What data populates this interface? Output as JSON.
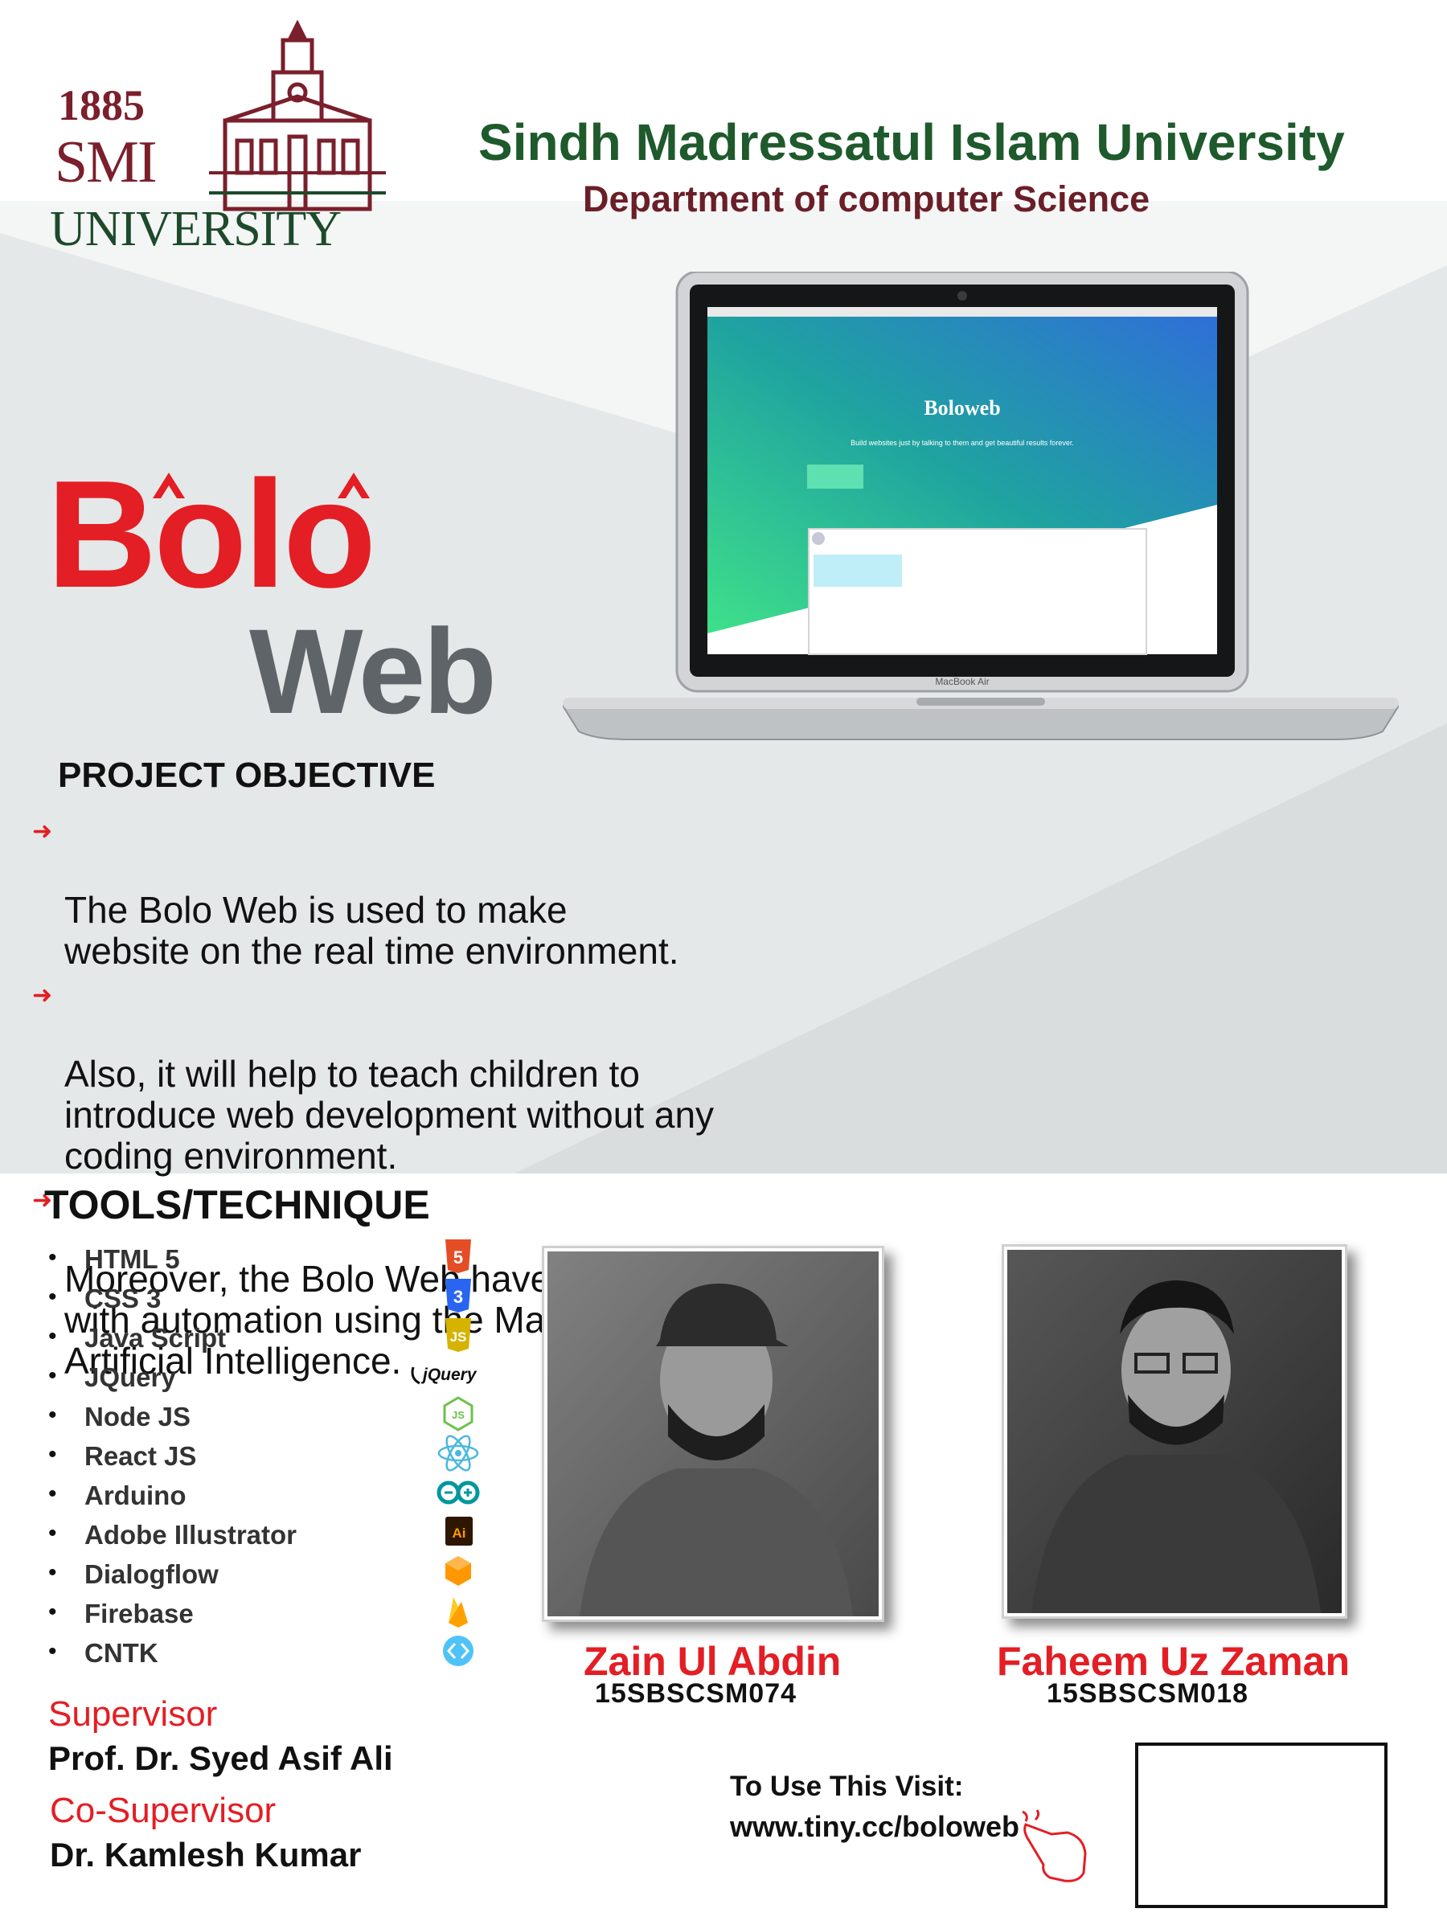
{
  "header": {
    "logo": {
      "year": "1885",
      "smi": "SMI",
      "university": "UNIVERSITY"
    },
    "university_title": "Sindh Madressatul Islam University",
    "department_title": "Department of computer Science"
  },
  "laptop_screen": {
    "app_title": "Boloweb",
    "tagline": "Build websites just by talking to them and get beautiful results forever.",
    "device_label": "MacBook Air"
  },
  "brand": {
    "line1": "Bolo",
    "line2": "Web"
  },
  "objective": {
    "title": "PROJECT OBJECTIVE",
    "items": [
      "The Bolo Web is used to make\nwebsite on the real time environment.",
      "Also, it will help to teach children to\nintroduce web development without any\ncoding environment.",
      "Moreover, the Bolo Web have the interaction\nwith automation using the Machine Learning and\nArtificial Intelligence."
    ]
  },
  "tools": {
    "title": "TOOLS/TECHNIQUE",
    "items": [
      {
        "name": "HTML 5",
        "icon": "html5-icon"
      },
      {
        "name": "CSS 3",
        "icon": "css3-icon"
      },
      {
        "name": "Java Script",
        "icon": "javascript-icon"
      },
      {
        "name": "JQuery",
        "icon": "jquery-icon"
      },
      {
        "name": "Node JS",
        "icon": "nodejs-icon"
      },
      {
        "name": "React JS",
        "icon": "react-icon"
      },
      {
        "name": "Arduino",
        "icon": "arduino-icon"
      },
      {
        "name": "Adobe Illustrator",
        "icon": "illustrator-icon"
      },
      {
        "name": "Dialogflow",
        "icon": "dialogflow-icon"
      },
      {
        "name": "Firebase",
        "icon": "firebase-icon"
      },
      {
        "name": "CNTK",
        "icon": "cntk-icon"
      }
    ],
    "icon_labels": {
      "jquery": "jQuery",
      "illustrator": "Ai"
    }
  },
  "members": [
    {
      "name": "Zain Ul Abdin",
      "id": "15SBSCSM074"
    },
    {
      "name": "Faheem Uz Zaman",
      "id": "15SBSCSM018"
    }
  ],
  "supervision": {
    "supervisor_label": "Supervisor",
    "supervisor_name": "Prof. Dr. Syed Asif Ali",
    "co_supervisor_label": "Co-Supervisor",
    "co_supervisor_name": "Dr. Kamlesh Kumar"
  },
  "visit": {
    "label": "To Use This Visit:",
    "url": "www.tiny.cc/boloweb"
  },
  "colors": {
    "accent_red": "#e31e24",
    "maroon": "#7a1f2b",
    "green": "#1e5a2c",
    "gray_text": "#5f6468",
    "background_gray": "#e4e7e7"
  }
}
